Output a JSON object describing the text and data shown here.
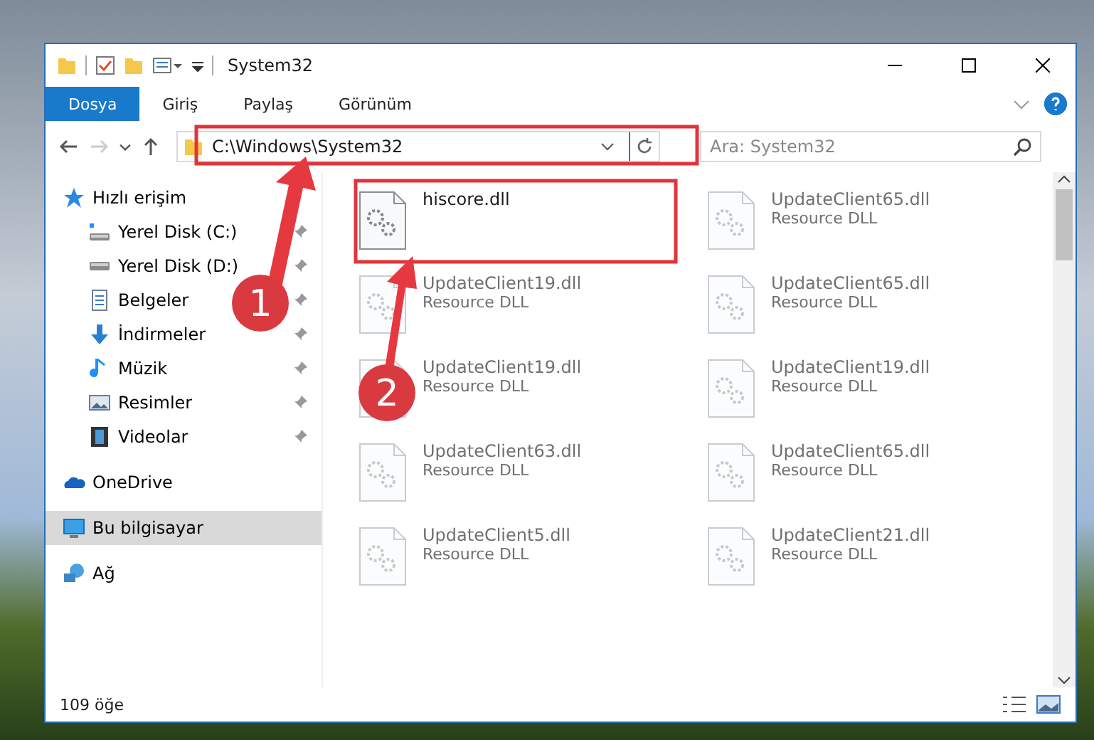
{
  "window": {
    "title": "System32"
  },
  "ribbon_tabs": [
    {
      "label": "Dosya",
      "selected": true
    },
    {
      "label": "Giriş",
      "selected": false
    },
    {
      "label": "Paylaş",
      "selected": false
    },
    {
      "label": "Görünüm",
      "selected": false
    }
  ],
  "address_bar": {
    "path": "C:\\Windows\\System32"
  },
  "search": {
    "placeholder": "Ara: System32"
  },
  "sidebar": {
    "items": [
      {
        "label": "Hızlı erişim",
        "kind": "star",
        "selected": false,
        "children": [
          {
            "label": "Yerel Disk (C:)",
            "kind": "system-drive",
            "selected": false,
            "pinned": true
          },
          {
            "label": "Yerel Disk (D:)",
            "kind": "drive",
            "selected": false,
            "pinned": true
          },
          {
            "label": "Belgeler",
            "kind": "document",
            "selected": false,
            "pinned": true
          },
          {
            "label": "İndirmeler",
            "kind": "download",
            "selected": false,
            "pinned": true
          },
          {
            "label": "Müzik",
            "kind": "music",
            "selected": false,
            "pinned": true
          },
          {
            "label": "Resimler",
            "kind": "picture",
            "selected": false,
            "pinned": true
          },
          {
            "label": "Videolar",
            "kind": "video",
            "selected": false,
            "pinned": true
          }
        ]
      },
      {
        "label": "OneDrive",
        "kind": "cloud",
        "selected": false
      },
      {
        "label": "Bu bilgisayar",
        "kind": "computer",
        "selected": true
      },
      {
        "label": "Ağ",
        "kind": "network",
        "selected": false
      }
    ]
  },
  "files": [
    {
      "name": "hiscore.dll",
      "faded": false
    },
    {
      "name": "UpdateClient65.dll",
      "type": "Resource DLL",
      "faded": true
    },
    {
      "name": "UpdateClient19.dll",
      "type": "Resource DLL",
      "faded": true
    },
    {
      "name": "UpdateClient65.dll",
      "type": "Resource DLL",
      "faded": true
    },
    {
      "name": "UpdateClient19.dll",
      "type": "Resource DLL",
      "faded": true
    },
    {
      "name": "UpdateClient19.dll",
      "type": "Resource DLL",
      "faded": true
    },
    {
      "name": "UpdateClient63.dll",
      "type": "Resource DLL",
      "faded": true
    },
    {
      "name": "UpdateClient65.dll",
      "type": "Resource DLL",
      "faded": true
    },
    {
      "name": "UpdateClient5.dll",
      "type": "Resource DLL",
      "faded": true
    },
    {
      "name": "UpdateClient21.dll",
      "type": "Resource DLL",
      "faded": true
    }
  ],
  "status_bar": {
    "count": "109 öğe"
  },
  "annotations": [
    {
      "label": "1"
    },
    {
      "label": "2"
    }
  ]
}
